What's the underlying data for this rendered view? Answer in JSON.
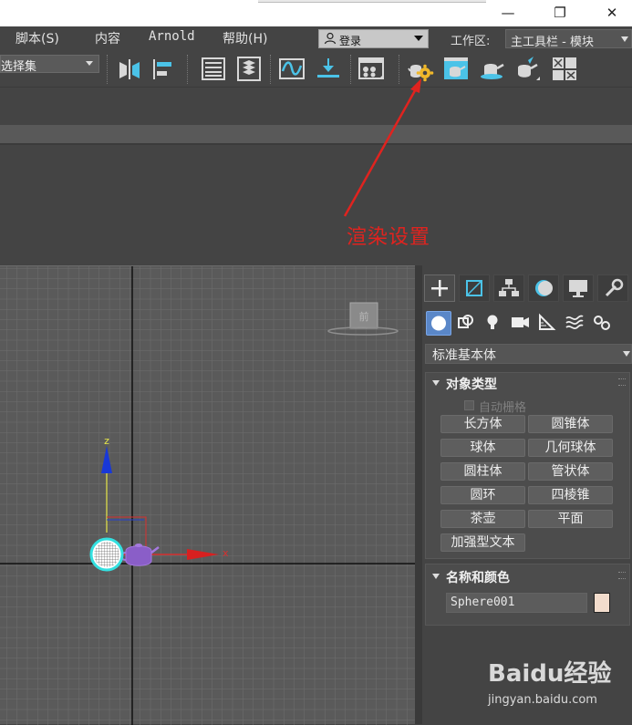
{
  "window": {
    "minimize_glyph": "—",
    "maximize_glyph": "❐",
    "close_glyph": "✕"
  },
  "menubar": {
    "items": [
      {
        "label": "脚本(S)"
      },
      {
        "label": "内容"
      },
      {
        "label": "Arnold"
      },
      {
        "label": "帮助(H)"
      }
    ],
    "login": {
      "label": "登录",
      "icon": "user-icon"
    },
    "workspace_label": "工作区:",
    "workspace_value": "主工具栏 - 模块"
  },
  "toolbar": {
    "selection_set": "选择集",
    "buttons": [
      {
        "name": "mirror-button",
        "icon": "mirror-icon"
      },
      {
        "name": "align-button",
        "icon": "align-icon"
      },
      {
        "name": "scene-explorer-button",
        "icon": "list-icon"
      },
      {
        "name": "layer-explorer-button",
        "icon": "layers-icon"
      },
      {
        "name": "curve-editor-button",
        "icon": "curve-icon"
      },
      {
        "name": "schematic-view-button",
        "icon": "schematic-icon"
      },
      {
        "name": "material-editor-button",
        "icon": "material-icon"
      },
      {
        "name": "render-setup-button",
        "icon": "teapot-gear-icon"
      },
      {
        "name": "rendered-frame-window-button",
        "icon": "teapot-window-icon"
      },
      {
        "name": "render-production-button",
        "icon": "teapot-icon"
      },
      {
        "name": "render-iterative-button",
        "icon": "teapot-render-icon"
      },
      {
        "name": "render-cloud-button",
        "icon": "grid-icon"
      }
    ]
  },
  "annotation": {
    "text": "渲染设置",
    "color": "#e0231f"
  },
  "viewport": {
    "z_label": "z",
    "x_label": "x",
    "viewcube_label": "前"
  },
  "command_panel": {
    "tabs": [
      "create-tab",
      "modify-tab",
      "hierarchy-tab",
      "motion-tab",
      "display-tab",
      "utilities-tab"
    ],
    "subtabs": [
      "geometry-icon",
      "shapes-icon",
      "lights-icon",
      "cameras-icon",
      "helpers-icon",
      "spacewarps-icon",
      "systems-icon"
    ],
    "category": "标准基本体",
    "object_type": {
      "title": "对象类型",
      "autogrid": "自动栅格",
      "buttons": [
        "长方体",
        "圆锥体",
        "球体",
        "几何球体",
        "圆柱体",
        "管状体",
        "圆环",
        "四棱锥",
        "茶壶",
        "平面",
        "加强型文本"
      ]
    },
    "name_color": {
      "title": "名称和颜色",
      "name": "Sphere001",
      "color": "#f2dccc"
    }
  },
  "watermark": {
    "logo": "Baidu经验",
    "url": "jingyan.baidu.com"
  }
}
